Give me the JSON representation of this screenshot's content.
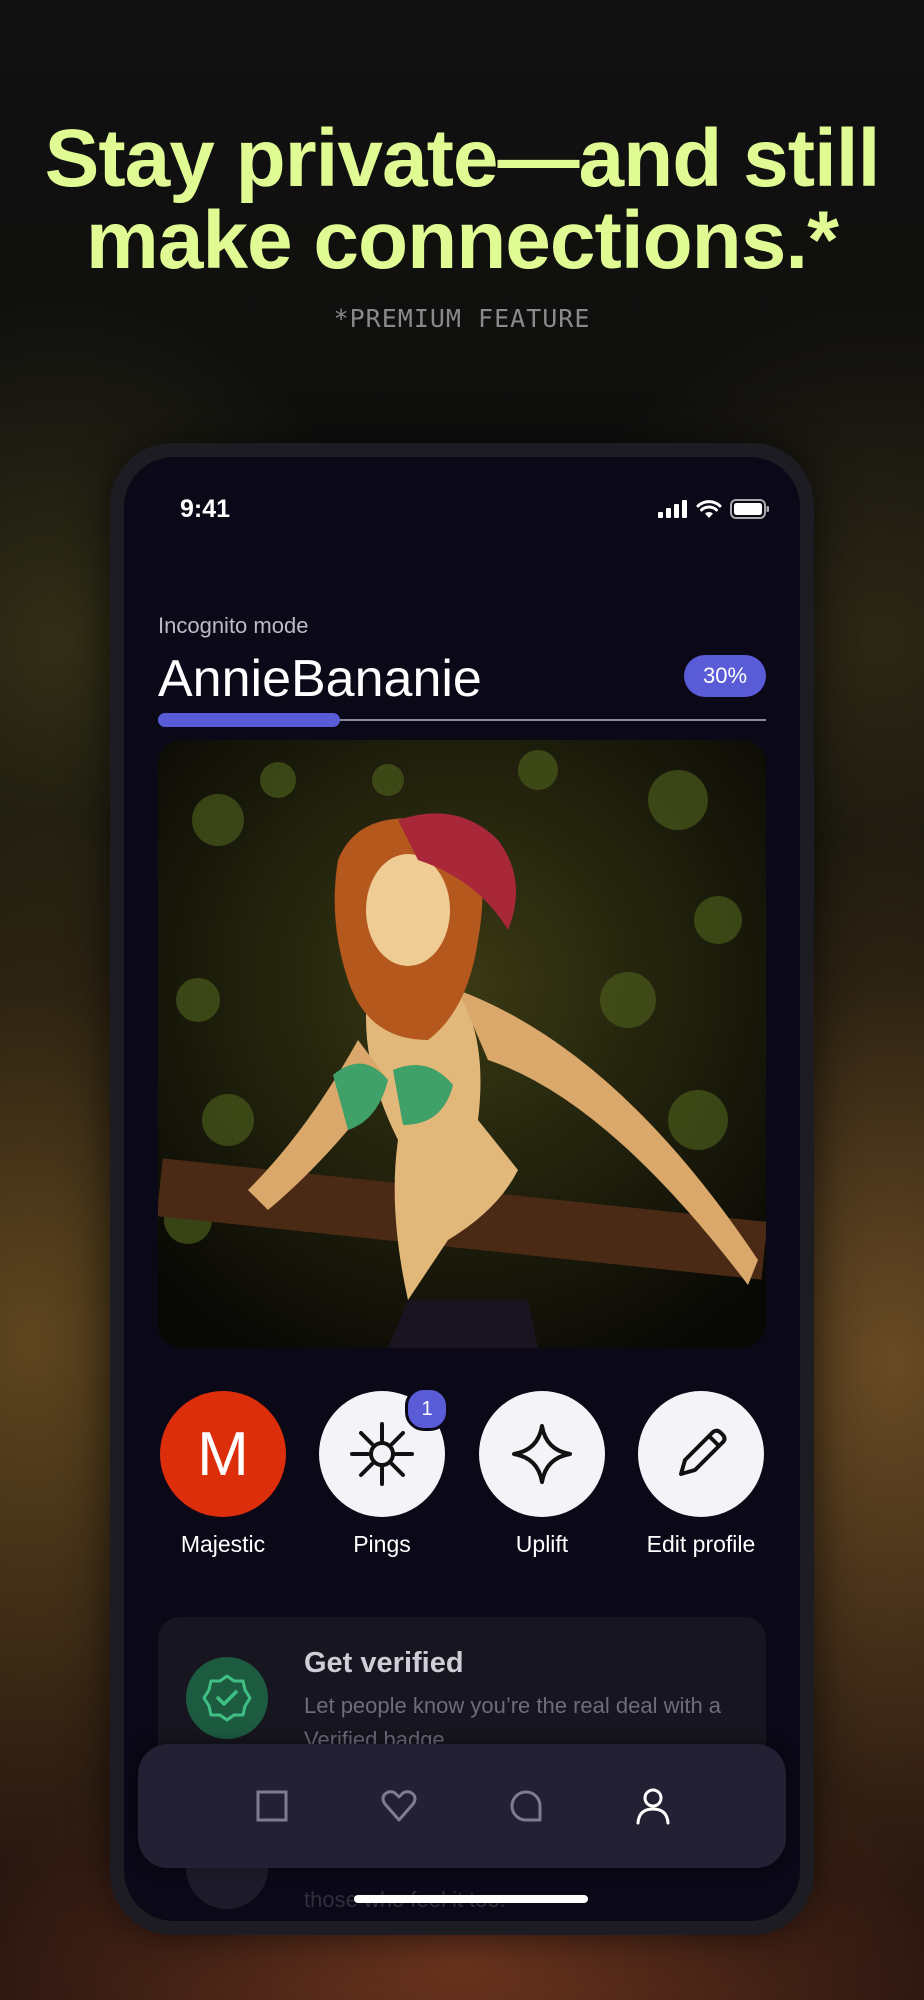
{
  "promo": {
    "headline": "Stay private—and still\nmake connections.*",
    "footnote": "*PREMIUM FEATURE"
  },
  "status_bar": {
    "time": "9:41",
    "icons": [
      "cellular-signal-icon",
      "wifi-icon",
      "battery-icon"
    ]
  },
  "profile": {
    "mode_label": "Incognito mode",
    "username": "AnnieBananie",
    "completion_percent": 30,
    "completion_label": "30%"
  },
  "actions": [
    {
      "label": "Majestic",
      "icon": "majestic-m-icon",
      "glyph": "M"
    },
    {
      "label": "Pings",
      "icon": "sun-ping-icon",
      "badge": "1"
    },
    {
      "label": "Uplift",
      "icon": "sparkle-icon"
    },
    {
      "label": "Edit profile",
      "icon": "pencil-icon"
    }
  ],
  "verify_card": {
    "title": "Get verified",
    "description": "Let people know you’re the real deal with a Verified badge."
  },
  "hidden_card": {
    "text": "those who feel it too."
  },
  "tab_bar": {
    "tabs": [
      "discover-square-icon",
      "likes-heart-icon",
      "chat-bubble-icon",
      "profile-person-icon"
    ],
    "active": "profile-person-icon"
  },
  "colors": {
    "headline": "#e0fb94",
    "accent": "#5a5bd6",
    "majestic_red": "#dd2e0b",
    "verify_green": "#1c5b40",
    "screen_bg": "#0b0817"
  }
}
